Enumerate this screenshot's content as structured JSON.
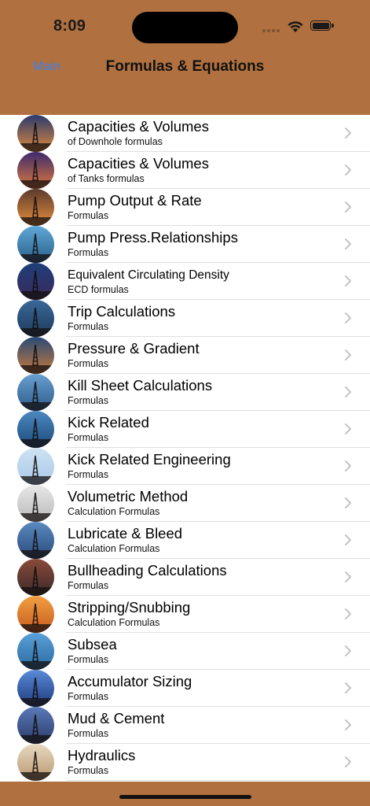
{
  "status": {
    "time": "8:09"
  },
  "nav": {
    "back_label": "Main",
    "title": "Formulas & Equations"
  },
  "items": [
    {
      "title": "Capacities & Volumes",
      "subtitle": "of Downhole formulas",
      "icon": "drilling-rig-sunset-photo",
      "sky": [
        "#2a3a6e",
        "#e08a3c"
      ]
    },
    {
      "title": "Capacities & Volumes",
      "subtitle": "of Tanks formulas",
      "icon": "worker-derrick-silhouette-photo",
      "sky": [
        "#3c2a6e",
        "#e07a3c"
      ]
    },
    {
      "title": "Pump Output & Rate",
      "subtitle": "Formulas",
      "icon": "derrick-sunset-photo",
      "sky": [
        "#5a3a2e",
        "#e88f3c"
      ]
    },
    {
      "title": "Pump Press.Relationships",
      "subtitle": "Formulas",
      "icon": "offshore-platform-photo",
      "sky": [
        "#5fa8d8",
        "#2a5e88"
      ]
    },
    {
      "title": "Equivalent Circulating Density",
      "subtitle": "ECD formulas",
      "icon": "offshore-rig-dusk-photo",
      "sky": [
        "#1e3e7a",
        "#3a2a5a"
      ]
    },
    {
      "title": "Trip Calculations",
      "subtitle": "Formulas",
      "icon": "offshore-rig-photo",
      "sky": [
        "#3a6898",
        "#1e3a5a"
      ]
    },
    {
      "title": "Pressure & Gradient",
      "subtitle": "Formulas",
      "icon": "rig-night-photo",
      "sky": [
        "#284a78",
        "#c87a3a"
      ]
    },
    {
      "title": "Kill Sheet Calculations",
      "subtitle": "Formulas",
      "icon": "drillship-photo",
      "sky": [
        "#6aa0d0",
        "#2a5a8a"
      ]
    },
    {
      "title": "Kick Related",
      "subtitle": "Formulas",
      "icon": "drillship-sea-photo",
      "sky": [
        "#4a88c0",
        "#1e4a7a"
      ]
    },
    {
      "title": "Kick Related Engineering",
      "subtitle": "Formulas",
      "icon": "land-rig-photo",
      "sky": [
        "#cfe2f2",
        "#a8c8e8"
      ]
    },
    {
      "title": "Volumetric Method",
      "subtitle": "Calculation Formulas",
      "icon": "wellhead-workers-photo",
      "sky": [
        "#e8e8e8",
        "#b8b8b8"
      ]
    },
    {
      "title": "Lubricate & Bleed",
      "subtitle": "Calculation Formulas",
      "icon": "pumpjack-blue-photo",
      "sky": [
        "#5a8ac0",
        "#2a4a7a"
      ]
    },
    {
      "title": "Bullheading Calculations",
      "subtitle": "Formulas",
      "icon": "pumpjack-dusk-photo",
      "sky": [
        "#8a4a3a",
        "#3a2a2a"
      ]
    },
    {
      "title": "Stripping/Snubbing",
      "subtitle": "Calculation Formulas",
      "icon": "pumpjack-sunset-photo",
      "sky": [
        "#f0a040",
        "#c85a20"
      ]
    },
    {
      "title": "Subsea",
      "subtitle": "Formulas",
      "icon": "subsea-platform-photo",
      "sky": [
        "#5aa0d8",
        "#2a6aa0"
      ]
    },
    {
      "title": "Accumulator Sizing",
      "subtitle": "Formulas",
      "icon": "workers-silhouette-photo",
      "sky": [
        "#5a8ad8",
        "#1e3a7a"
      ]
    },
    {
      "title": "Mud & Cement",
      "subtitle": "Formulas",
      "icon": "pumpjack-workers-photo",
      "sky": [
        "#5a7ab8",
        "#2a3a6a"
      ]
    },
    {
      "title": "Hydraulics",
      "subtitle": "Formulas",
      "icon": "pumpjack-hazy-photo",
      "sky": [
        "#e8d8c0",
        "#b89870"
      ]
    }
  ]
}
